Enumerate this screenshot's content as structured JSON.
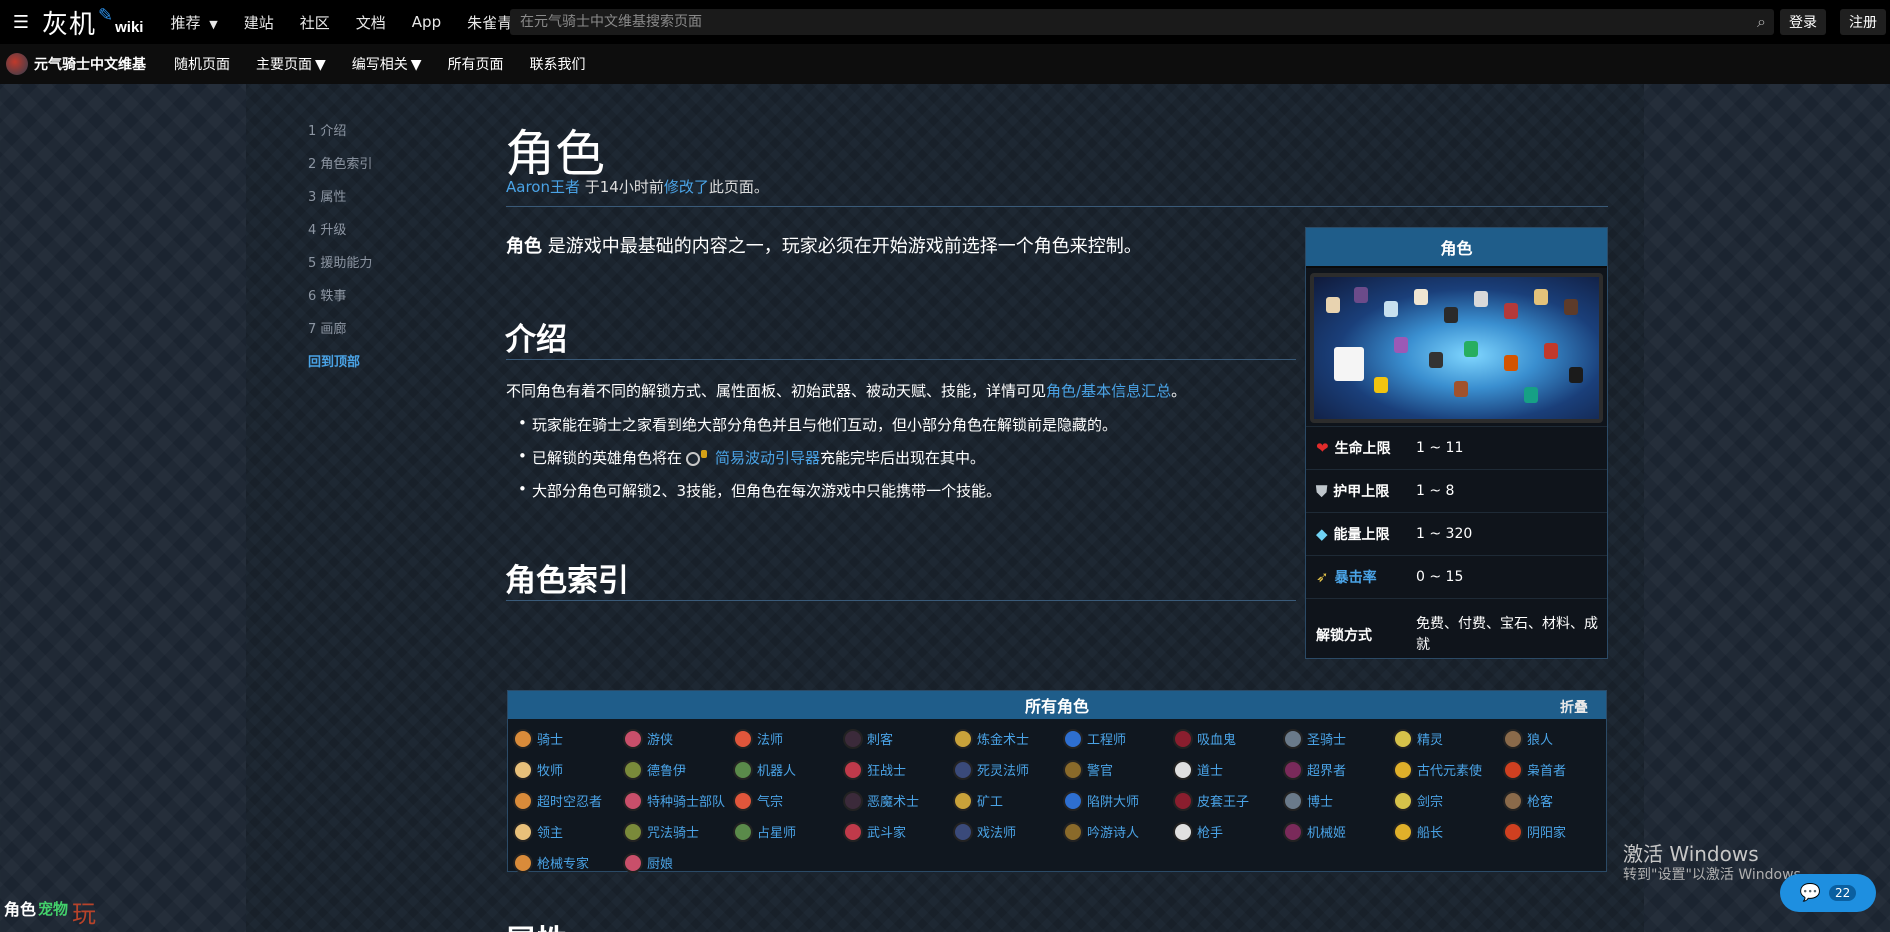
{
  "topbar": {
    "menu_icon": "menu-icon",
    "logo_cn": "灰机",
    "logo_wiki": "wiki",
    "nav": [
      "推荐",
      "建站",
      "社区",
      "文档",
      "App",
      "朱雀青龙"
    ],
    "search_placeholder": "在元气骑士中文维基搜索页面",
    "login": "登录",
    "register": "注册"
  },
  "subbar": {
    "site_name": "元气骑士中文维基",
    "items": [
      "随机页面",
      "主要页面",
      "编写相关",
      "所有页面",
      "联系我们"
    ]
  },
  "toc": {
    "items": [
      "1 介绍",
      "2 角色索引",
      "3 属性",
      "4 升级",
      "5 援助能力",
      "6 轶事",
      "7 画廊"
    ],
    "back_to_top": "回到顶部"
  },
  "page": {
    "title": "角色",
    "meta_user": "Aaron王者",
    "meta_mid": " 于14小时前",
    "meta_link": "修改了",
    "meta_end": "此页面。",
    "lead_bold": "角色",
    "lead_rest": " 是游戏中最基础的内容之一，玩家必须在开始游戏前选择一个角色来控制。",
    "h_intro": "介绍",
    "intro_text": "不同角色有着不同的解锁方式、属性面板、初始武器、被动天赋、技能，详情可见",
    "intro_link": "角色/基本信息汇总",
    "intro_end": "。",
    "bullet1": "玩家能在骑士之家看到绝大部分角色并且与他们互动，但小部分角色在解锁前是隐藏的。",
    "bullet2_pre": "已解锁的英雄角色将在",
    "bullet2_link": "简易波动引导器",
    "bullet2_post": "充能完毕后出现在其中。",
    "bullet3": "大部分角色可解锁2、3技能，但角色在每次游戏中只能携带一个技能。",
    "h_index": "角色索引",
    "h_attr": "属性"
  },
  "infobox": {
    "title": "角色",
    "rows": [
      {
        "label": "生命上限",
        "value": "1 ~ 11",
        "icon": "heart-icon"
      },
      {
        "label": "护甲上限",
        "value": "1 ~ 8",
        "icon": "shield-icon"
      },
      {
        "label": "能量上限",
        "value": "1 ~ 320",
        "icon": "diamond-icon"
      },
      {
        "label": "暴击率",
        "value": "0 ~ 15",
        "icon": "critical-icon"
      },
      {
        "label": "解锁方式",
        "value": "免费、付费、宝石、材料、成就"
      }
    ]
  },
  "roles": {
    "title": "所有角色",
    "fold": "折叠",
    "items": [
      "骑士",
      "游侠",
      "法师",
      "刺客",
      "炼金术士",
      "工程师",
      "吸血鬼",
      "圣骑士",
      "精灵",
      "狼人",
      "牧师",
      "德鲁伊",
      "机器人",
      "狂战士",
      "死灵法师",
      "警官",
      "道士",
      "超界者",
      "古代元素使",
      "枭首者",
      "超时空忍者",
      "特种骑士部队",
      "气宗",
      "恶魔术士",
      "矿工",
      "陷阱大师",
      "皮套王子",
      "博士",
      "剑宗",
      "枪客",
      "领主",
      "咒法骑士",
      "占星师",
      "武斗家",
      "戏法师",
      "吟游诗人",
      "枪手",
      "机械姬",
      "船长",
      "阴阳家",
      "枪械专家",
      "厨娘"
    ]
  },
  "colors": {
    "accent": "#1f5d8a",
    "link": "#4aa3e6"
  },
  "bottom_logo": {
    "a": "角色",
    "b": "宠物",
    "c": "玩"
  },
  "watermark": {
    "line1": "激活 Windows",
    "line2": "转到\"设置\"以激活 Windows。"
  },
  "chat": {
    "count": "22",
    "icon": "chat-icon"
  }
}
